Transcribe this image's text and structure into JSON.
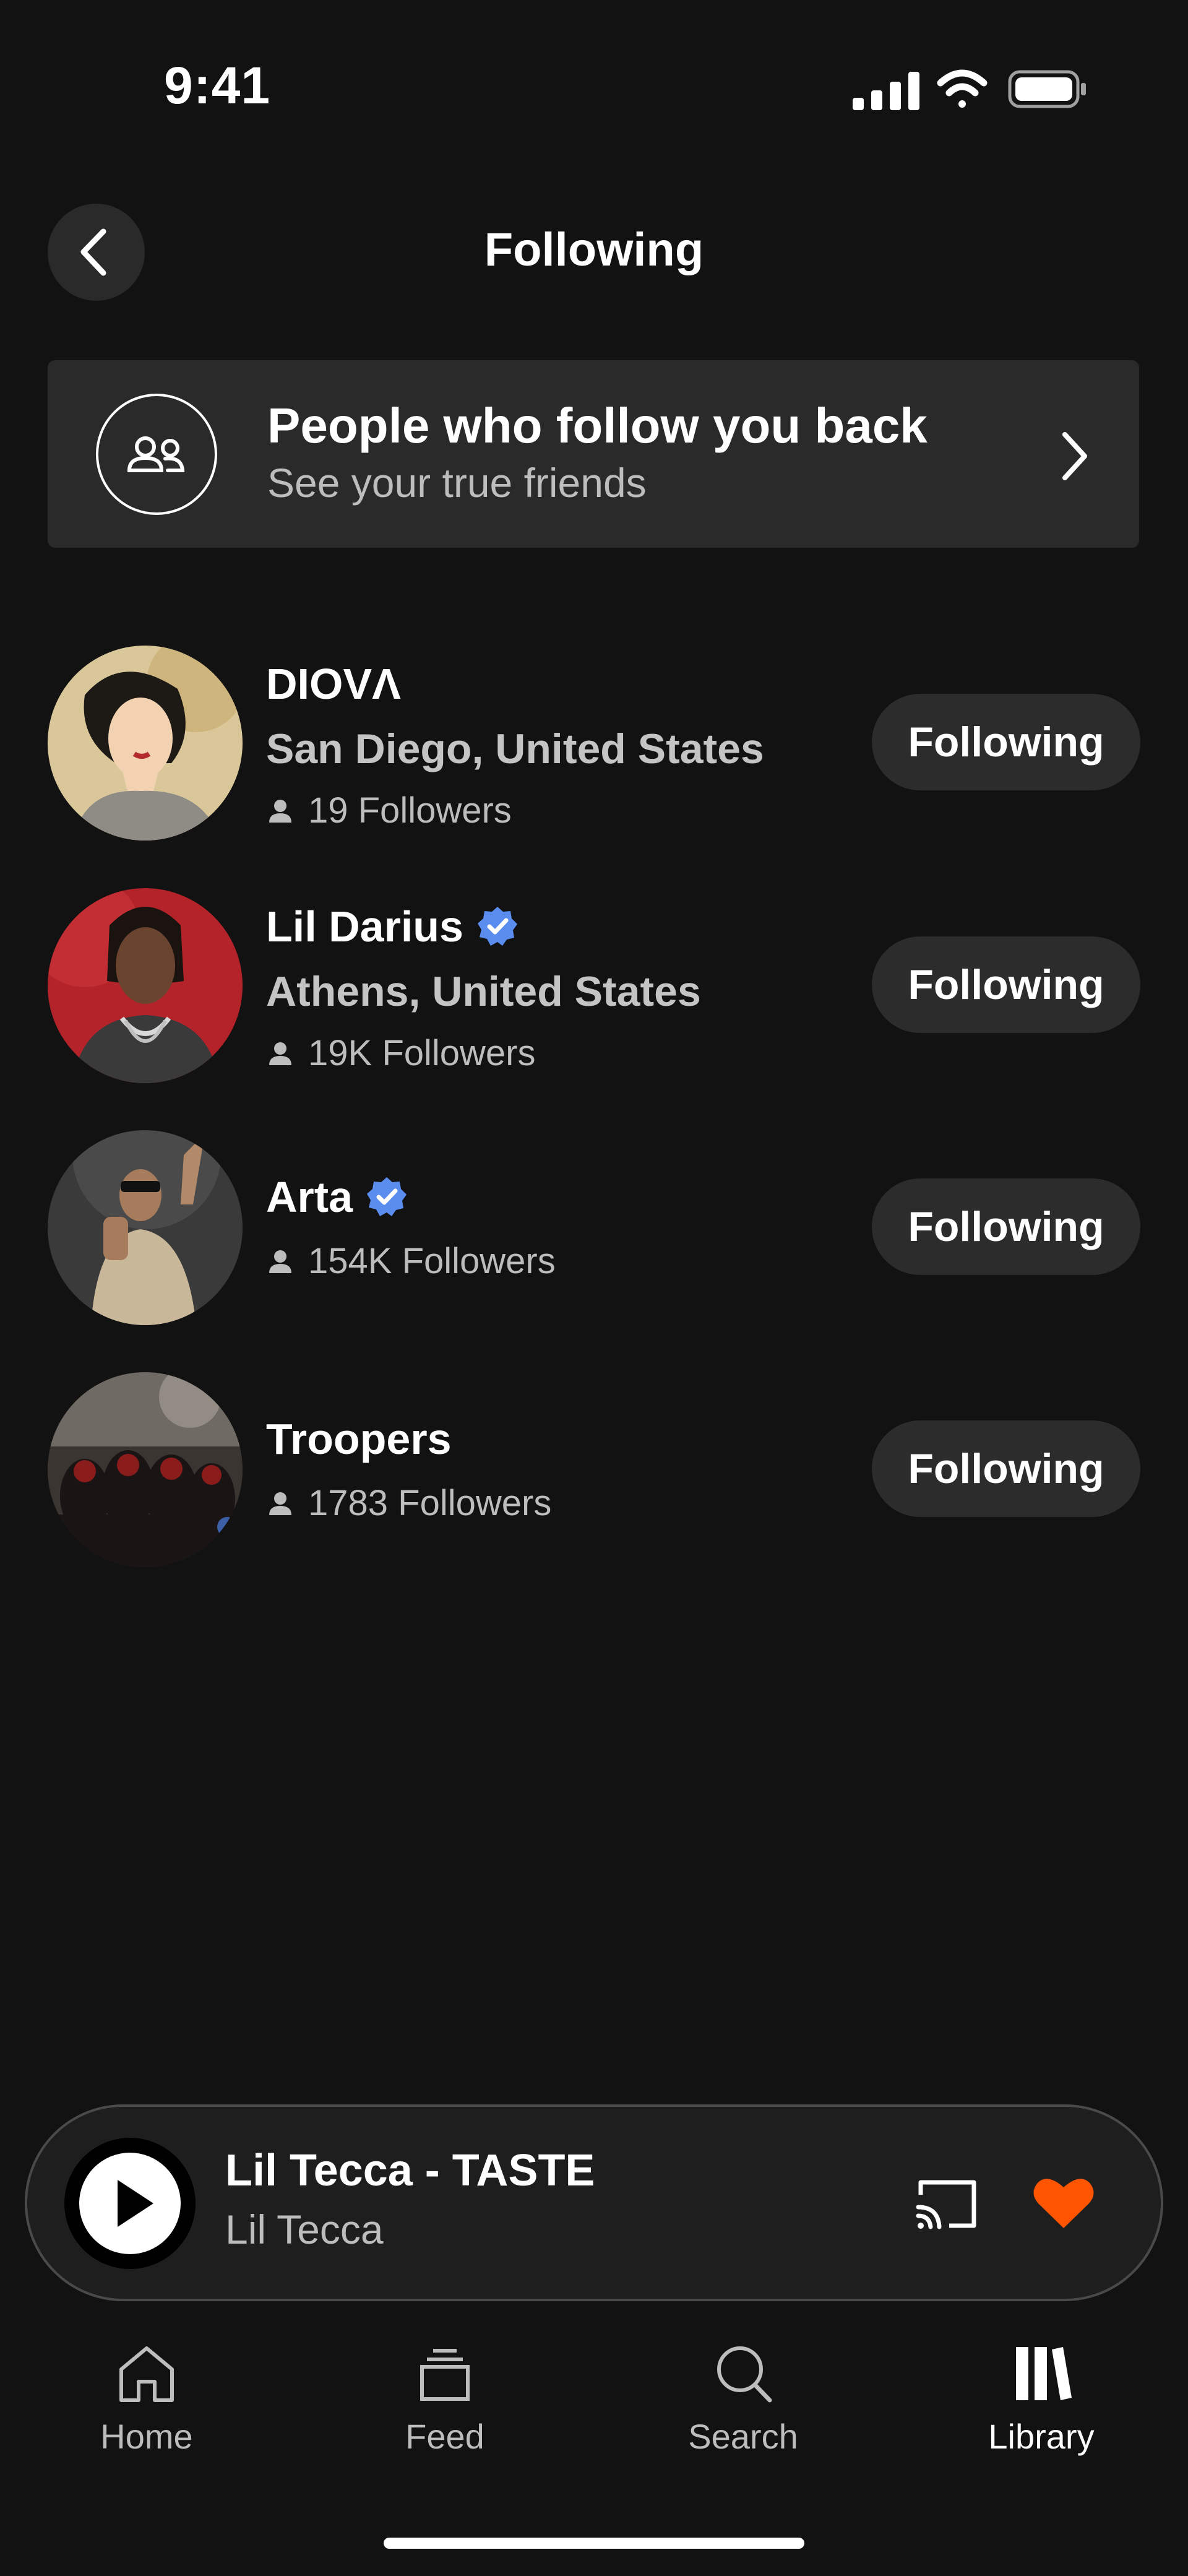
{
  "status_bar": {
    "time": "9:41"
  },
  "header": {
    "title": "Following"
  },
  "follow_back_card": {
    "title": "People who follow you back",
    "subtitle": "See your true friends"
  },
  "following": [
    {
      "name": "DIOVΛ",
      "verified": false,
      "location": "San Diego, United States",
      "followers": "19 Followers",
      "button_label": "Following"
    },
    {
      "name": "Lil Darius",
      "verified": true,
      "location": "Athens, United States",
      "followers": "19K Followers",
      "button_label": "Following"
    },
    {
      "name": "Arta",
      "verified": true,
      "location": "",
      "followers": "154K Followers",
      "button_label": "Following"
    },
    {
      "name": "Troopers",
      "verified": false,
      "location": "",
      "followers": "1783 Followers",
      "button_label": "Following"
    }
  ],
  "mini_player": {
    "title": "Lil Tecca - TASTE",
    "artist": "Lil Tecca",
    "liked": true
  },
  "bottom_nav": {
    "items": [
      {
        "label": "Home",
        "icon": "home-icon",
        "active": false
      },
      {
        "label": "Feed",
        "icon": "feed-icon",
        "active": false
      },
      {
        "label": "Search",
        "icon": "search-icon",
        "active": false
      },
      {
        "label": "Library",
        "icon": "library-icon",
        "active": true
      }
    ]
  },
  "colors": {
    "background": "#121212",
    "card": "#2a2a2a",
    "verified": "#5b8def",
    "like": "#ff5500"
  }
}
